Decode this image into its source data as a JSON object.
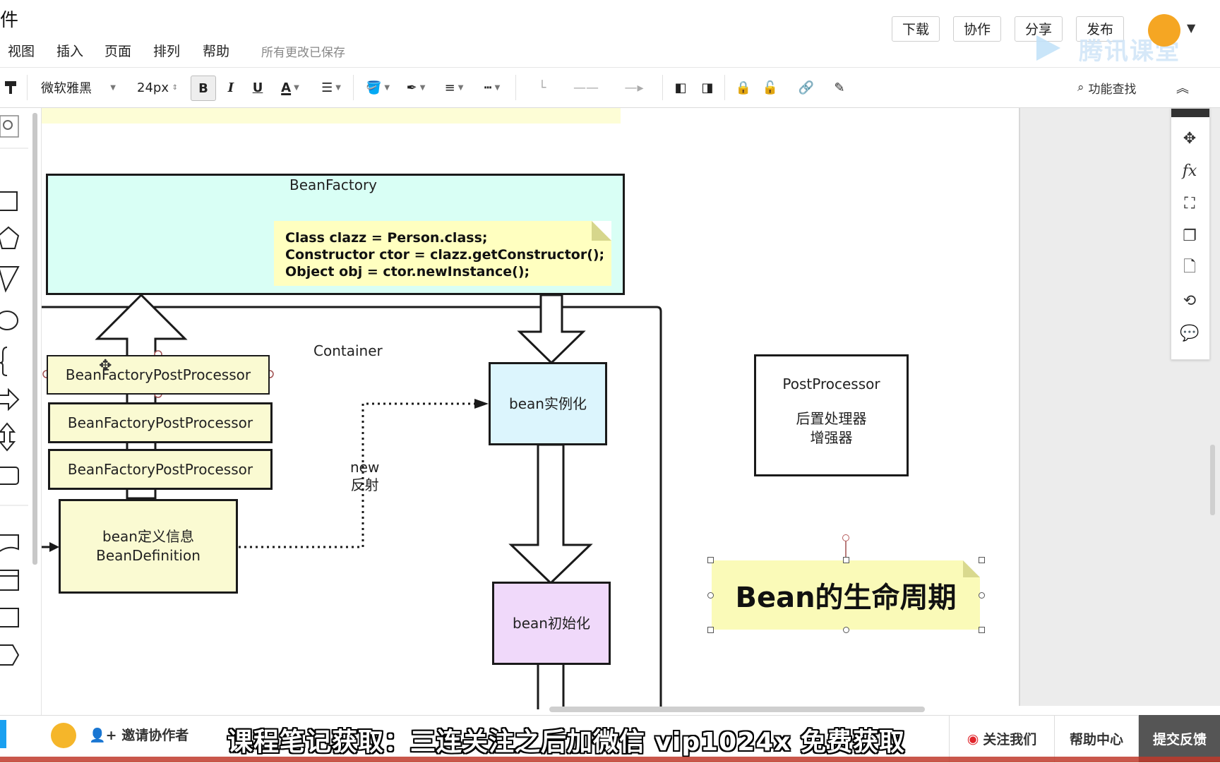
{
  "app": {
    "title_fragment": "件",
    "save_status": "所有更改已保存",
    "watermark": "腾讯课堂"
  },
  "menu": [
    "视图",
    "插入",
    "页面",
    "排列",
    "帮助"
  ],
  "top_buttons": {
    "download": "下载",
    "collaborate": "协作",
    "share": "分享",
    "publish": "发布"
  },
  "toolbar": {
    "font_family": "微软雅黑",
    "font_size": "24px",
    "bold": "B",
    "italic": "I",
    "underline": "U",
    "font_color": "A",
    "search_label": "功能查找"
  },
  "diagram": {
    "bean_factory": "BeanFactory",
    "code_lines": "Class clazz = Person.class;\nConstructor ctor = clazz.getConstructor();\nObject obj = ctor.newInstance();",
    "bfpp_1": "BeanFactoryPostProcessor",
    "bfpp_2": "BeanFactoryPostProcessor",
    "bfpp_3": "BeanFactoryPostProcessor",
    "container": "Container",
    "bean_definition": "bean定义信息\nBeanDefinition",
    "new_reflect": "new\n反射",
    "bean_instantiate": "bean实例化",
    "bean_init": "bean初始化",
    "post_processor_title": "PostProcessor",
    "post_processor_desc": "后置处理器\n增强器",
    "lifecycle_title": "Bean的生命周期"
  },
  "bottom": {
    "invite": "邀请协作者",
    "subtitle": "课程笔记获取：三连关注之后加微信 vip1024x 免费获取",
    "follow_us": "关注我们",
    "help_center": "帮助中心",
    "feedback": "提交反馈"
  },
  "colors": {
    "bean_factory_fill": "#d9fff5",
    "note_fill": "#ffffc0",
    "bfpp_fill": "#fafad2",
    "instantiate_fill": "#dcf5fd",
    "init_fill": "#f0d9fa",
    "feedback_bg": "#555555",
    "avatar": "#f5a623"
  }
}
